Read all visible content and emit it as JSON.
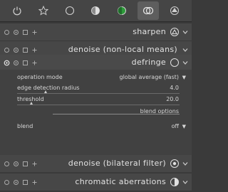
{
  "tabs": [
    {
      "icon": "power-icon",
      "active": false
    },
    {
      "icon": "star-icon",
      "active": false
    },
    {
      "icon": "circle-icon",
      "active": false
    },
    {
      "icon": "half-circle-icon",
      "active": false
    },
    {
      "icon": "color-circle-icon",
      "active": false
    },
    {
      "icon": "correct-icon",
      "active": true
    },
    {
      "icon": "effect-icon",
      "active": false
    }
  ],
  "modules": {
    "sharpen": {
      "title": "sharpen"
    },
    "denoise_nlm": {
      "title": "denoise (non-local means)"
    },
    "defringe": {
      "title": "defringe",
      "operation_mode_label": "operation mode",
      "operation_mode_value": "global average (fast)",
      "edge_radius_label": "edge detection radius",
      "edge_radius_value": "4.0",
      "threshold_label": "threshold",
      "threshold_value": "20.0",
      "blend_options_label": "blend options",
      "blend_label": "blend",
      "blend_value": "off"
    },
    "denoise_bilateral": {
      "title": "denoise (bilateral filter)"
    },
    "chromatic": {
      "title": "chromatic aberrations"
    }
  },
  "colors": {
    "background": "#3a3a3a",
    "header": "#474747",
    "text": "#d7d7d7"
  }
}
